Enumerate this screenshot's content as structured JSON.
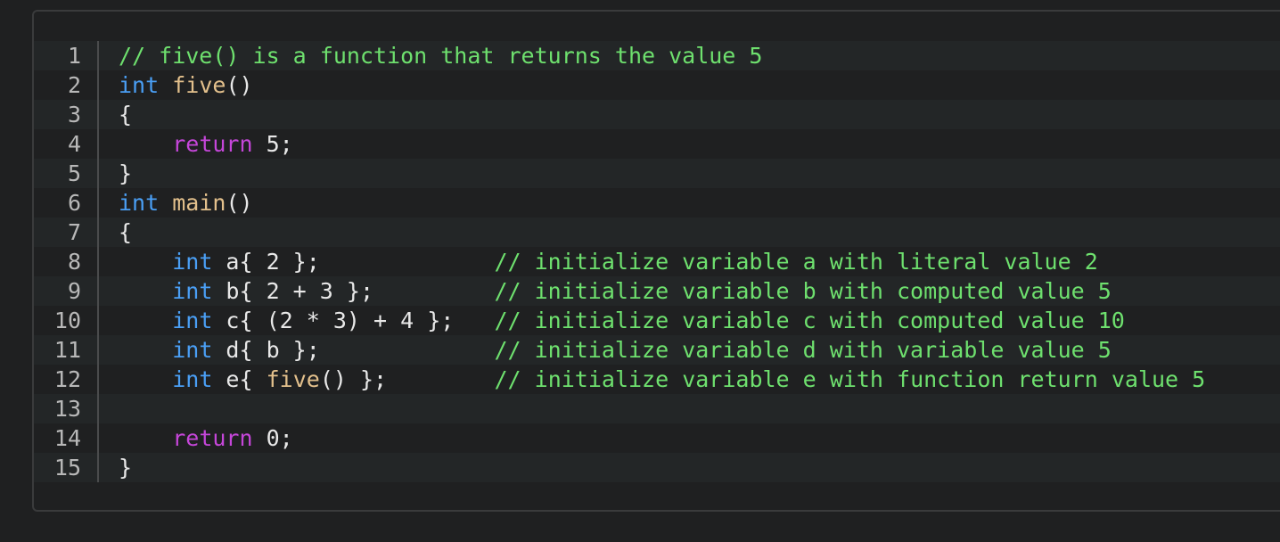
{
  "colors": {
    "background": "#1f2021",
    "keyword": "#4a9ff5",
    "return_keyword": "#c546d9",
    "function_name": "#e3c08c",
    "comment": "#6ee06e",
    "text": "#e8e8e8",
    "line_number": "#b8b8b8"
  },
  "lines": [
    {
      "n": "1",
      "tokens": [
        {
          "t": "// five() is a function that returns the value 5",
          "c": "cmt"
        }
      ]
    },
    {
      "n": "2",
      "tokens": [
        {
          "t": "int",
          "c": "kw"
        },
        {
          "t": " ",
          "c": "pl"
        },
        {
          "t": "five",
          "c": "fn"
        },
        {
          "t": "()",
          "c": "pl"
        }
      ]
    },
    {
      "n": "3",
      "tokens": [
        {
          "t": "{",
          "c": "pl"
        }
      ]
    },
    {
      "n": "4",
      "tokens": [
        {
          "t": "    ",
          "c": "pl"
        },
        {
          "t": "return",
          "c": "ret"
        },
        {
          "t": " 5;",
          "c": "pl"
        }
      ]
    },
    {
      "n": "5",
      "tokens": [
        {
          "t": "}",
          "c": "pl"
        }
      ]
    },
    {
      "n": "6",
      "tokens": [
        {
          "t": "int",
          "c": "kw"
        },
        {
          "t": " ",
          "c": "pl"
        },
        {
          "t": "main",
          "c": "fn"
        },
        {
          "t": "()",
          "c": "pl"
        }
      ]
    },
    {
      "n": "7",
      "tokens": [
        {
          "t": "{",
          "c": "pl"
        }
      ]
    },
    {
      "n": "8",
      "tokens": [
        {
          "t": "    ",
          "c": "pl"
        },
        {
          "t": "int",
          "c": "kw"
        },
        {
          "t": " a{ 2 };             ",
          "c": "pl"
        },
        {
          "t": "// initialize variable a with literal value 2",
          "c": "cmt"
        }
      ]
    },
    {
      "n": "9",
      "tokens": [
        {
          "t": "    ",
          "c": "pl"
        },
        {
          "t": "int",
          "c": "kw"
        },
        {
          "t": " b{ 2 + 3 };         ",
          "c": "pl"
        },
        {
          "t": "// initialize variable b with computed value 5",
          "c": "cmt"
        }
      ]
    },
    {
      "n": "10",
      "tokens": [
        {
          "t": "    ",
          "c": "pl"
        },
        {
          "t": "int",
          "c": "kw"
        },
        {
          "t": " c{ (2 * 3) + 4 };   ",
          "c": "pl"
        },
        {
          "t": "// initialize variable c with computed value 10",
          "c": "cmt"
        }
      ]
    },
    {
      "n": "11",
      "tokens": [
        {
          "t": "    ",
          "c": "pl"
        },
        {
          "t": "int",
          "c": "kw"
        },
        {
          "t": " d{ b };             ",
          "c": "pl"
        },
        {
          "t": "// initialize variable d with variable value 5",
          "c": "cmt"
        }
      ]
    },
    {
      "n": "12",
      "tokens": [
        {
          "t": "    ",
          "c": "pl"
        },
        {
          "t": "int",
          "c": "kw"
        },
        {
          "t": " e{ ",
          "c": "pl"
        },
        {
          "t": "five",
          "c": "fn"
        },
        {
          "t": "() };        ",
          "c": "pl"
        },
        {
          "t": "// initialize variable e with function return value 5",
          "c": "cmt"
        }
      ]
    },
    {
      "n": "13",
      "tokens": []
    },
    {
      "n": "14",
      "tokens": [
        {
          "t": "    ",
          "c": "pl"
        },
        {
          "t": "return",
          "c": "ret"
        },
        {
          "t": " 0;",
          "c": "pl"
        }
      ]
    },
    {
      "n": "15",
      "tokens": [
        {
          "t": "}",
          "c": "pl"
        }
      ]
    }
  ]
}
